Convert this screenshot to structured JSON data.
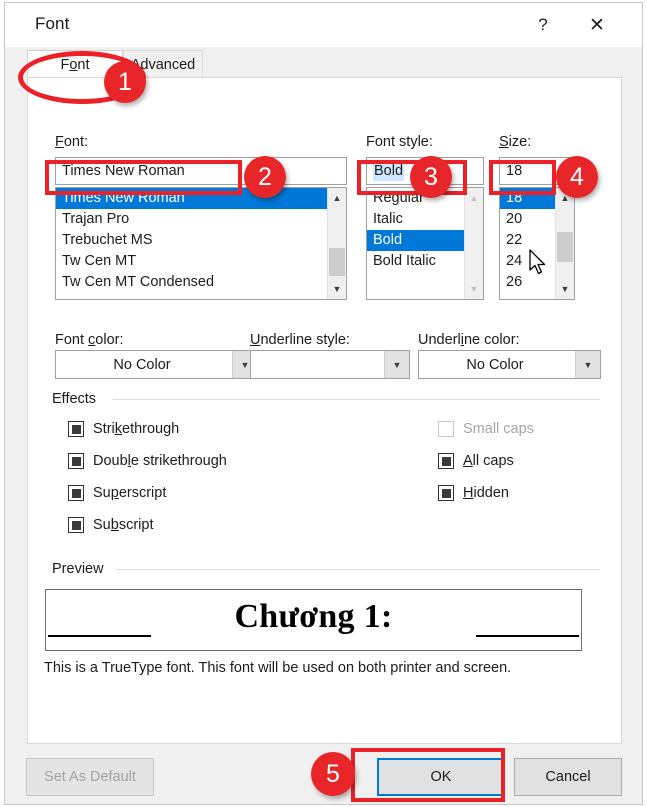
{
  "window": {
    "title": "Font",
    "help_icon": "question-mark-icon",
    "close_icon": "close-icon"
  },
  "tabs": [
    {
      "label": "Font",
      "accel_index": 2,
      "active": true
    },
    {
      "label": "Advanced",
      "accel_index": 0,
      "active": false
    }
  ],
  "font_section": {
    "label": "Font:",
    "input_value": "Times New Roman",
    "list_items": [
      "Times New Roman",
      "Trajan Pro",
      "Trebuchet MS",
      "Tw Cen MT",
      "Tw Cen MT Condensed"
    ],
    "selected_item": "Times New Roman"
  },
  "style_section": {
    "label": "Font style:",
    "input_value": "Bold",
    "list_items": [
      "Regular",
      "Italic",
      "Bold",
      "Bold Italic"
    ],
    "selected_item": "Bold"
  },
  "size_section": {
    "label": "Size:",
    "input_value": "18",
    "list_items": [
      "18",
      "20",
      "22",
      "24",
      "26"
    ],
    "selected_item": "18"
  },
  "color_row": {
    "font_color": {
      "label": "Font color:",
      "value": "No Color"
    },
    "underline_style": {
      "label": "Underline style:",
      "value": ""
    },
    "underline_color": {
      "label": "Underline color:",
      "value": "No Color"
    }
  },
  "effects": {
    "group_label": "Effects",
    "left_column": [
      {
        "label": "Strikethrough",
        "state": "indeterminate",
        "disabled": false
      },
      {
        "label": "Double strikethrough",
        "state": "indeterminate",
        "disabled": false
      },
      {
        "label": "Superscript",
        "state": "indeterminate",
        "disabled": false
      },
      {
        "label": "Subscript",
        "state": "indeterminate",
        "disabled": false
      }
    ],
    "right_column": [
      {
        "label": "Small caps",
        "state": "unchecked",
        "disabled": true
      },
      {
        "label": "All caps",
        "state": "indeterminate",
        "disabled": false
      },
      {
        "label": "Hidden",
        "state": "indeterminate",
        "disabled": false
      }
    ]
  },
  "preview": {
    "group_label": "Preview",
    "sample_text": "Chương 1:",
    "note": "This is a TrueType font. This font will be used on both printer and screen."
  },
  "footer": {
    "set_as_default": "Set As Default",
    "ok": "OK",
    "cancel": "Cancel"
  },
  "annotations": {
    "accent_color": "#ec2027",
    "badge_color": "#e8262a",
    "badges": [
      "1",
      "2",
      "3",
      "4",
      "5"
    ]
  }
}
